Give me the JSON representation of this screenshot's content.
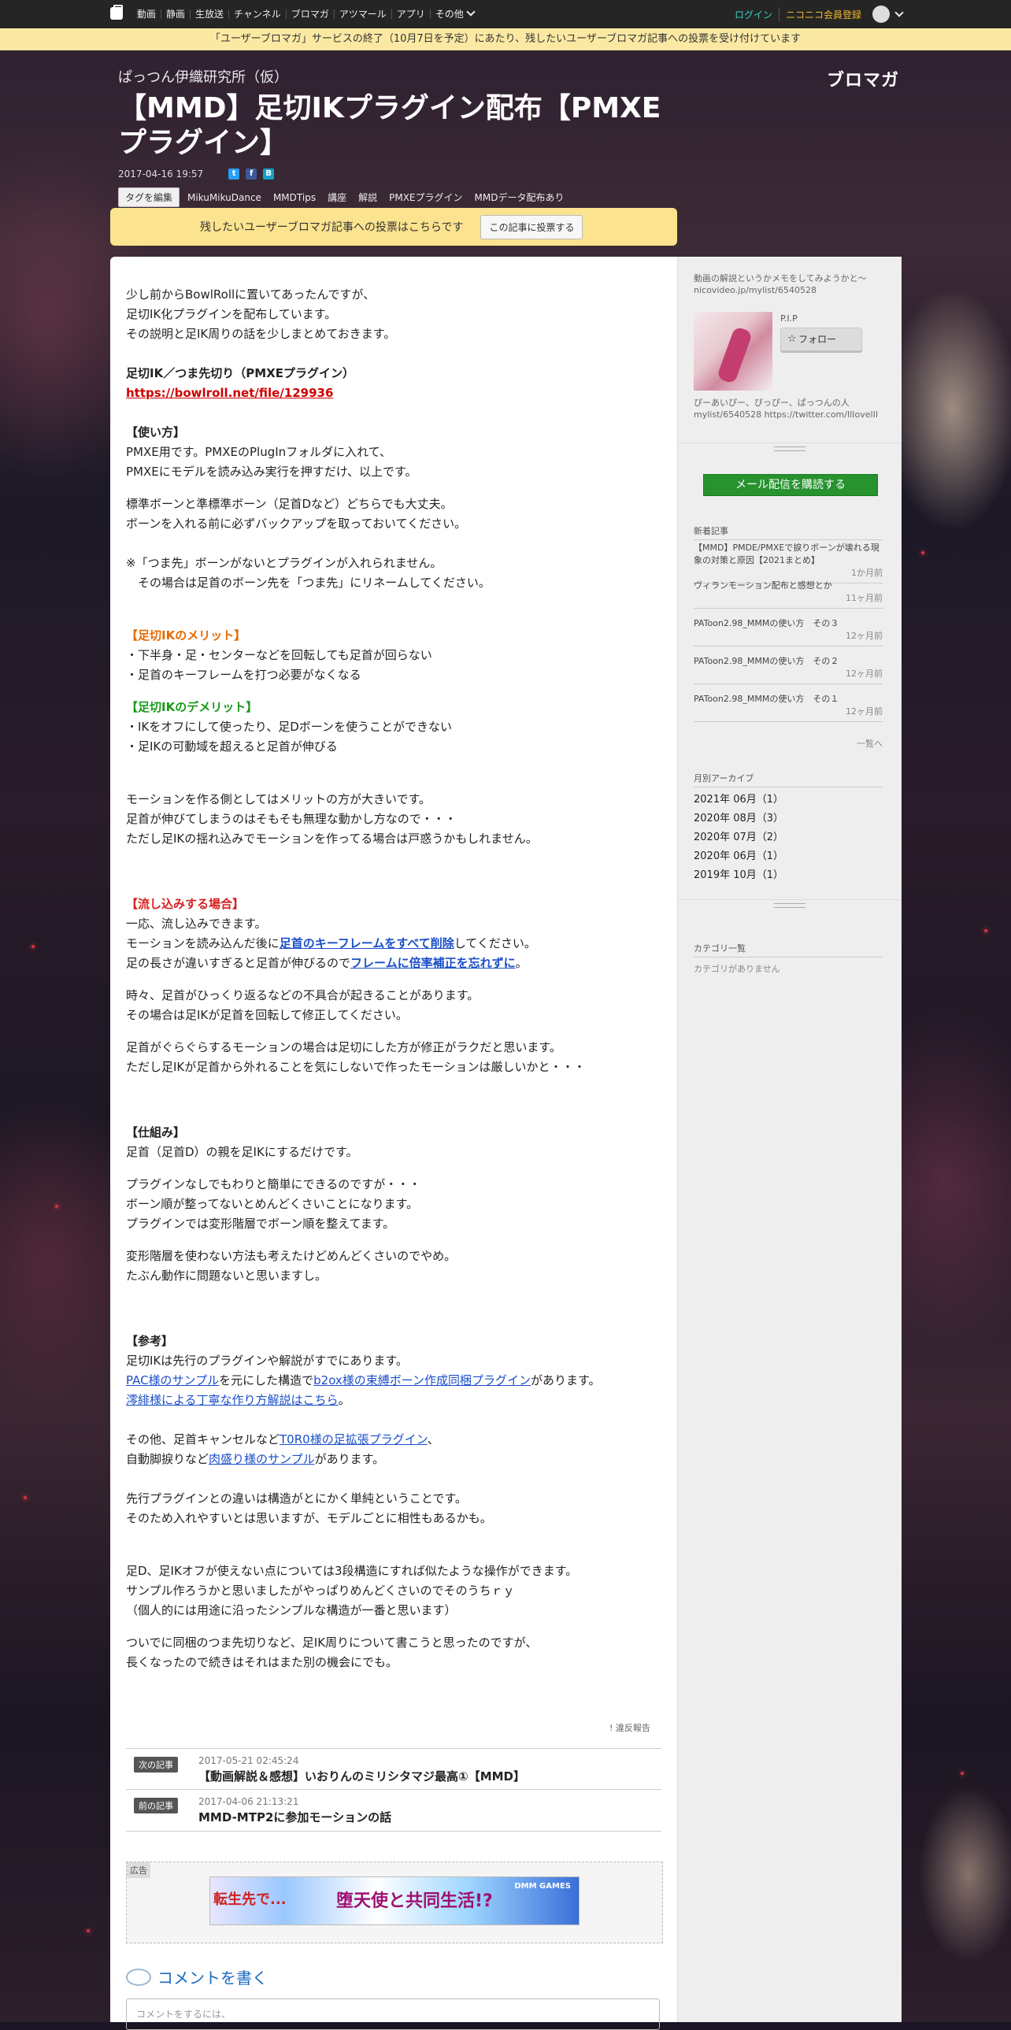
{
  "global_nav": {
    "items": [
      "動画",
      "静画",
      "生放送",
      "チャンネル",
      "ブロマガ",
      "アツマール",
      "アプリ",
      "その他"
    ],
    "login": "ログイン",
    "register": "ニコニコ会員登録"
  },
  "notice": "「ユーザーブロマガ」サービスの終了（10月7日を予定）にあたり、残したいユーザーブロマガ記事への投票を受け付けています",
  "header": {
    "channel": "ぱっつん伊織研究所（仮）",
    "title": "【MMD】足切IKプラグイン配布【PMXEプラグイン】",
    "datetime": "2017-04-16 19:57",
    "service_logo": "ブロマガ",
    "tag_edit": "タグを編集",
    "tags": [
      "MikuMikuDance",
      "MMDTips",
      "講座",
      "解説",
      "PMXEプラグイン",
      "MMDデータ配布あり"
    ]
  },
  "vote": {
    "text": "残したいユーザーブロマガ記事への投票はこちらです",
    "button": "この記事に投票する"
  },
  "article": {
    "intro": [
      "少し前からBowlRollに置いてあったんですが、",
      "足切IK化プラグインを配布しています。",
      "その説明と足IK周りの話を少しまとめておきます。"
    ],
    "dl_title": "足切IK／つま先切り（PMXEプラグイン）",
    "dl_link": "https://bowlroll.net/file/129936",
    "usage_head": "【使い方】",
    "usage_1": [
      "PMXE用です。PMXEのPlugInフォルダに入れて、",
      "PMXEにモデルを読み込み実行を押すだけ、以上です。"
    ],
    "usage_2": [
      "標準ボーンと準標準ボーン（足首Dなど）どちらでも大丈夫。",
      "ボーンを入れる前に必ずバックアップを取っておいてください。"
    ],
    "usage_3": [
      "※「つま先」ボーンがないとプラグインが入れられません。",
      "　その場合は足首のボーン先を「つま先」にリネームしてください。"
    ],
    "merit_head": "【足切IKのメリット】",
    "merit": [
      "・下半身・足・センターなどを回転しても足首が回らない",
      "・足首のキーフレームを打つ必要がなくなる"
    ],
    "demerit_head": "【足切IKのデメリット】",
    "demerit": [
      "・IKをオフにして使ったり、足Dボーンを使うことができない",
      "・足IKの可動域を超えると足首が伸びる"
    ],
    "motion": [
      "モーションを作る側としてはメリットの方が大きいです。",
      "足首が伸びてしまうのはそもそも無理な動かし方なので・・・",
      "ただし足IKの揺れ込みでモーションを作ってる場合は戸惑うかもしれません。"
    ],
    "pour_head": "【流し込みする場合】",
    "pour_1": "一応、流し込みできます。",
    "pour_2a": "モーションを読み込んだ後に",
    "pour_2link": "足首のキーフレームをすべて削除",
    "pour_2b": "してください。",
    "pour_3a": "足の長さが違いすぎると足首が伸びるので",
    "pour_3link": "フレームに倍率補正を忘れずに",
    "pour_3b": "。",
    "pour_4": [
      "時々、足首がひっくり返るなどの不具合が起きることがあります。",
      "その場合は足IKが足首を回転して修正してください。"
    ],
    "pour_5": [
      "足首がぐらぐらするモーションの場合は足切にした方が修正がラクだと思います。",
      "ただし足IKが足首から外れることを気にしないで作ったモーションは厳しいかと・・・"
    ],
    "mech_head": "【仕組み】",
    "mech_1": "足首（足首D）の親を足IKにするだけです。",
    "mech_2": [
      "プラグインなしでもわりと簡単にできるのですが・・・",
      "ボーン順が整ってないとめんどくさいことになります。",
      "プラグインでは変形階層でボーン順を整えてます。"
    ],
    "mech_3": [
      "変形階層を使わない方法も考えたけどめんどくさいのでやめ。",
      "たぶん動作に問題ないと思いますし。"
    ],
    "ref_head": "【参考】",
    "ref_1": "足切IKは先行のプラグインや解説がすでにあります。",
    "ref_2link1": "PAC様のサンプル",
    "ref_2mid": "を元にした構造で",
    "ref_2link2": "b2ox様の束縛ボーン作成同梱プラグイン",
    "ref_2end": "があります。",
    "ref_3link": "澪緋様による丁寧な作り方解説はこちら",
    "ref_3end": "。",
    "other_1a": "その他、足首キャンセルなど",
    "other_1link": "T0R0様の足拡張プラグイン",
    "other_1b": "、",
    "other_2a": "自動脚捩りなど",
    "other_2link": "肉盛り様のサンプル",
    "other_2b": "があります。",
    "diff": [
      "先行プラグインとの違いは構造がとにかく単純ということです。",
      "そのため入れやすいとは思いますが、モデルごとに相性もあるかも。"
    ],
    "d_note": [
      "足D、足IKオフが使えない点については3段構造にすれば似たような操作ができます。",
      "サンプル作ろうかと思いましたがやっぱりめんどくさいのでそのうちｒｙ",
      "（個人的には用途に沿ったシンプルな構造が一番と思います）"
    ],
    "closing": [
      "ついでに同梱のつま先切りなど、足IK周りについて書こうと思ったのですが、",
      "長くなったので続きはそれはまた別の機会にでも。"
    ]
  },
  "report": "! 違反報告",
  "next_article": {
    "label": "次の記事",
    "date": "2017-05-21 02:45:24",
    "title": "【動画解説＆感想】いおりんのミリシタマジ最高①【MMD】"
  },
  "prev_article": {
    "label": "前の記事",
    "date": "2017-04-06 21:13:21",
    "title": "MMD-MTP2に参加モーションの話"
  },
  "ad": {
    "label": "広告",
    "banner_left": "転生先で...",
    "banner_mid": "堕天使と共同生活!?",
    "banner_right": "DMM GAMES"
  },
  "comment": {
    "title": "コメントを書く",
    "placeholder": "コメントをするには、"
  },
  "sidebar": {
    "profile_desc": "動画の解説というかメモをしてみようかと～ nicovideo.jp/mylist/6540528",
    "profile_name": "P.I.P",
    "follow": "フォロー",
    "profile_sub": "ぴーあいぴー、ぴっぴー、ぱっつんの人 mylist/6540528 https://twitter.com/IlIovelII",
    "mail": "メール配信を購読する",
    "news_title": "新着記事",
    "news": [
      {
        "title": "【MMD】PMDE/PMXEで捩りボーンが壊れる現象の対策と原因【2021まとめ】",
        "ago": "1か月前"
      },
      {
        "title": "ヴィランモーション配布と感想とか",
        "ago": "11ヶ月前"
      },
      {
        "title": "PAToon2.98_MMMの使い方　その３",
        "ago": "12ヶ月前"
      },
      {
        "title": "PAToon2.98_MMMの使い方　その２",
        "ago": "12ヶ月前"
      },
      {
        "title": "PAToon2.98_MMMの使い方　その１",
        "ago": "12ヶ月前"
      }
    ],
    "more": "一覧へ",
    "archive_title": "月別アーカイブ",
    "archive": [
      "2021年 06月（1）",
      "2020年 08月（3）",
      "2020年 07月（2）",
      "2020年 06月（1）",
      "2019年 10月（1）"
    ],
    "category_title": "カテゴリ一覧",
    "category_empty": "カテゴリがありません"
  }
}
